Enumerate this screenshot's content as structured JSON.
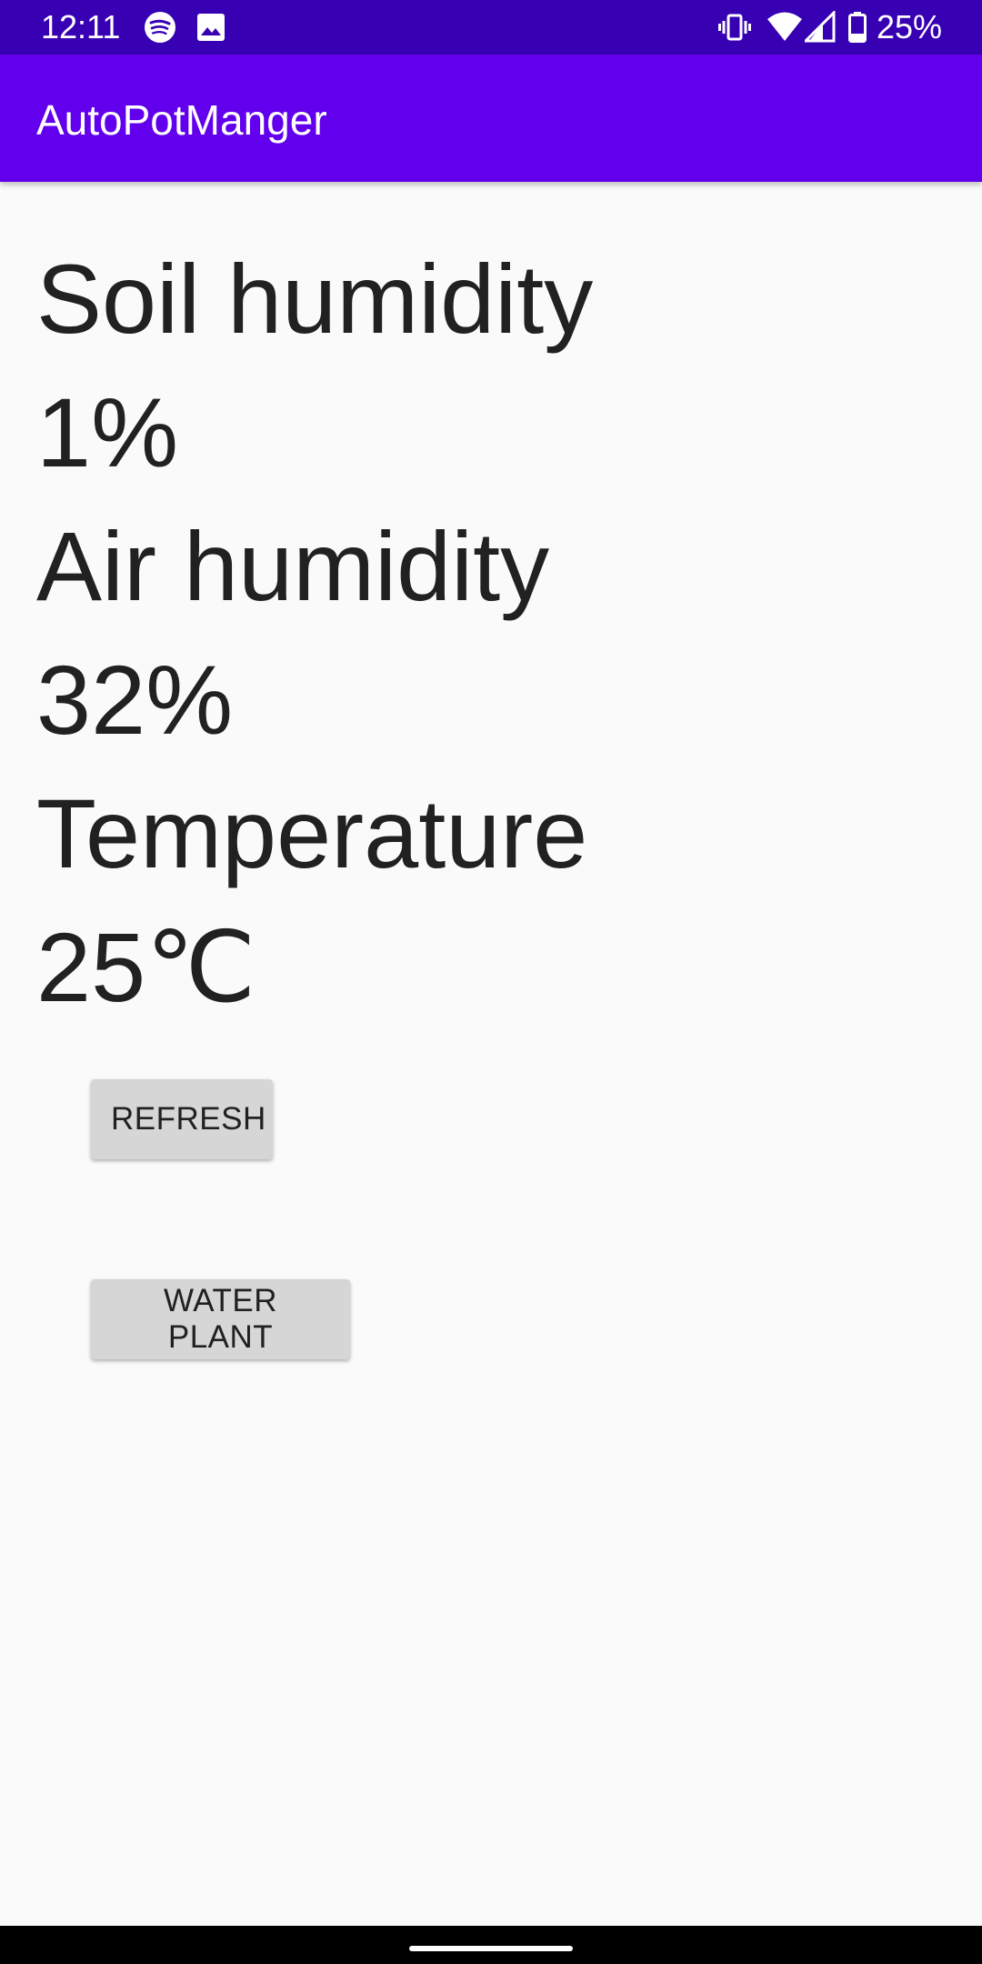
{
  "status_bar": {
    "time": "12:11",
    "battery_text": "25%",
    "icons": [
      "spotify-icon",
      "image-icon",
      "vibrate-icon",
      "wifi-icon",
      "cellular-signal-icon",
      "battery-icon"
    ]
  },
  "app_bar": {
    "title": "AutoPotManger",
    "color": "#6200ee",
    "status_color": "#3700b3"
  },
  "readings": {
    "soil_label": "Soil humidity",
    "soil_value": "1%",
    "air_label": "Air humidity",
    "air_value": "32%",
    "temp_label": "Temperature",
    "temp_value": "25℃"
  },
  "buttons": {
    "refresh_label": "REFRESH",
    "water_label": "WATER PLANT"
  }
}
